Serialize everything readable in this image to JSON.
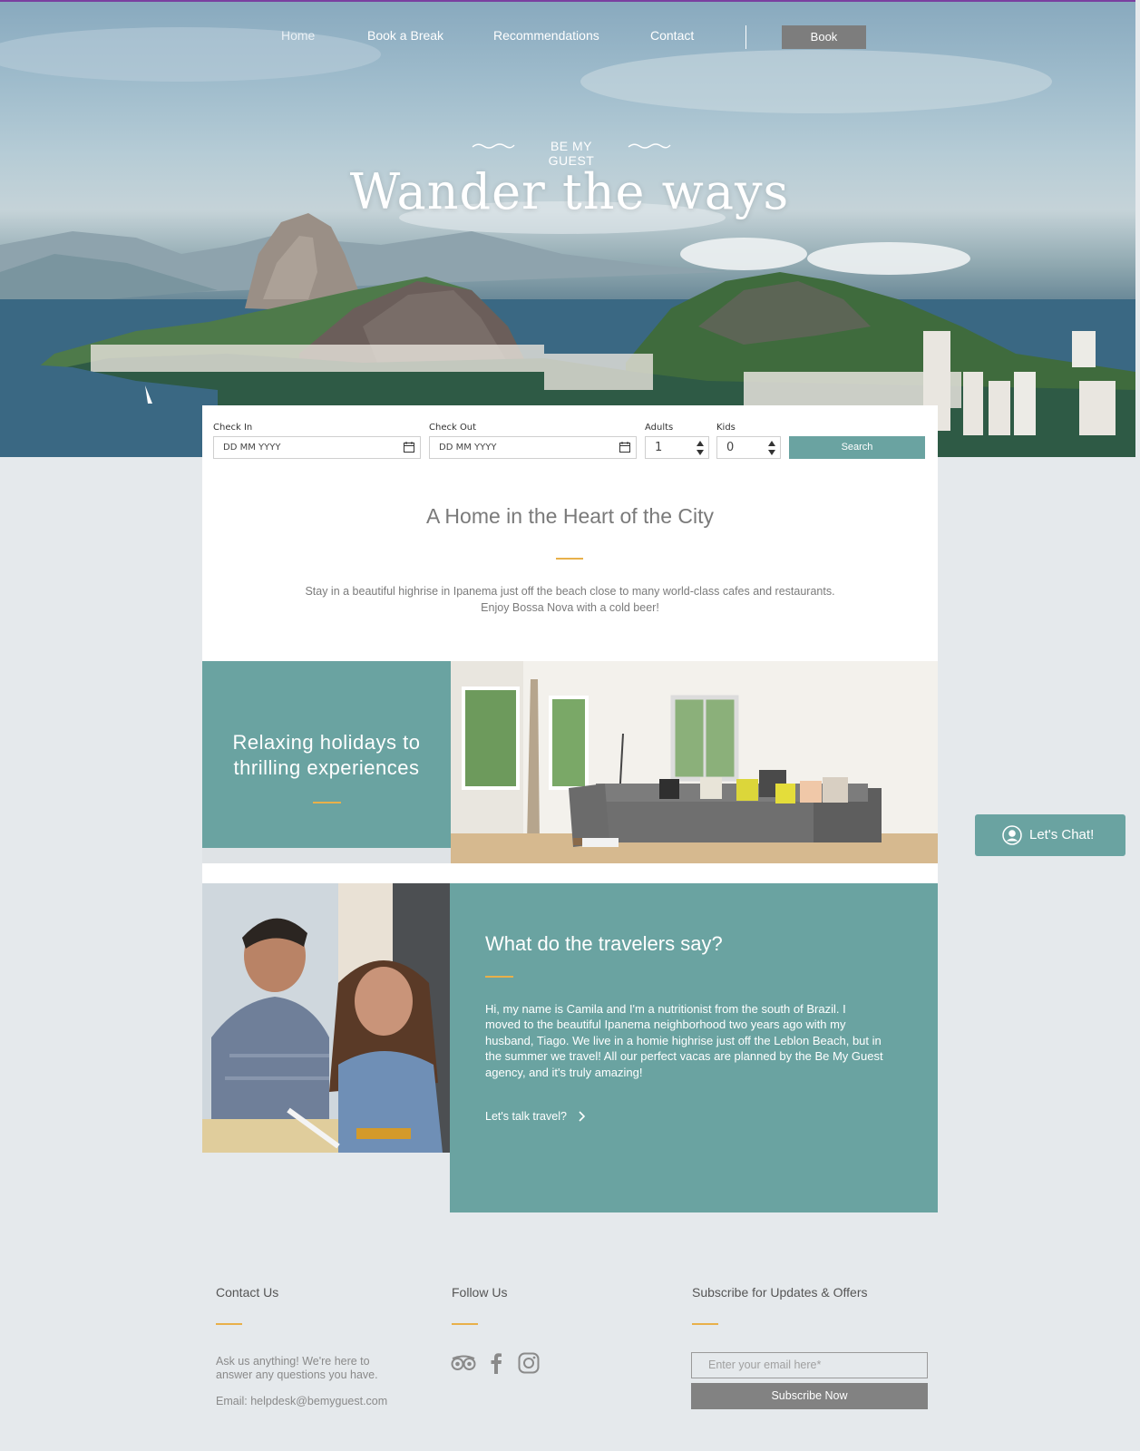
{
  "nav": {
    "items": [
      {
        "label": "Home"
      },
      {
        "label": "Book a Break"
      },
      {
        "label": "Recommendations"
      },
      {
        "label": "Contact"
      }
    ],
    "book_label": "Book"
  },
  "hero": {
    "eyebrow": "BE MY GUEST",
    "title": "Wander the ways"
  },
  "booking": {
    "check_in": {
      "label": "Check In",
      "placeholder": "DD MM YYYY"
    },
    "check_out": {
      "label": "Check Out",
      "placeholder": "DD MM YYYY"
    },
    "adults": {
      "label": "Adults",
      "value": "1"
    },
    "kids": {
      "label": "Kids",
      "value": "0"
    },
    "search_label": "Search"
  },
  "intro": {
    "title": "A Home in the Heart of the City",
    "line1": "Stay in a beautiful highrise in Ipanema just off the beach close to many world-class cafes and restaurants.",
    "line2": "Enjoy Bossa Nova with a cold beer!"
  },
  "feature": {
    "line1": "Relaxing holidays to",
    "line2": "thrilling experiences"
  },
  "travelers": {
    "title": "What do the travelers say?",
    "text": "Hi, my name is Camila and I'm a nutritionist from the south of Brazil. I moved to the beautiful Ipanema neighborhood two years ago with my husband, Tiago. We live in a homie highrise just off the Leblon Beach, but in the summer we travel! All our perfect vacas are planned by the Be My Guest agency, and it's truly amazing!",
    "link": "Let's talk travel?"
  },
  "chat": {
    "label": "Let's Chat!"
  },
  "footer": {
    "contact": {
      "title": "Contact Us",
      "line1": "Ask us anything! We're here to",
      "line2": "answer any questions you have.",
      "email": "Email: helpdesk@bemyguest.com"
    },
    "follow": {
      "title": "Follow Us",
      "icons": [
        "tripadvisor-icon",
        "facebook-icon",
        "instagram-icon"
      ]
    },
    "subscribe": {
      "title": "Subscribe for Updates & Offers",
      "placeholder": "Enter your email here*",
      "button": "Subscribe Now"
    }
  },
  "colors": {
    "teal": "#6aa3a1",
    "gold": "#e8b04a",
    "background": "#e5e9ec",
    "button_gray": "#828282"
  }
}
